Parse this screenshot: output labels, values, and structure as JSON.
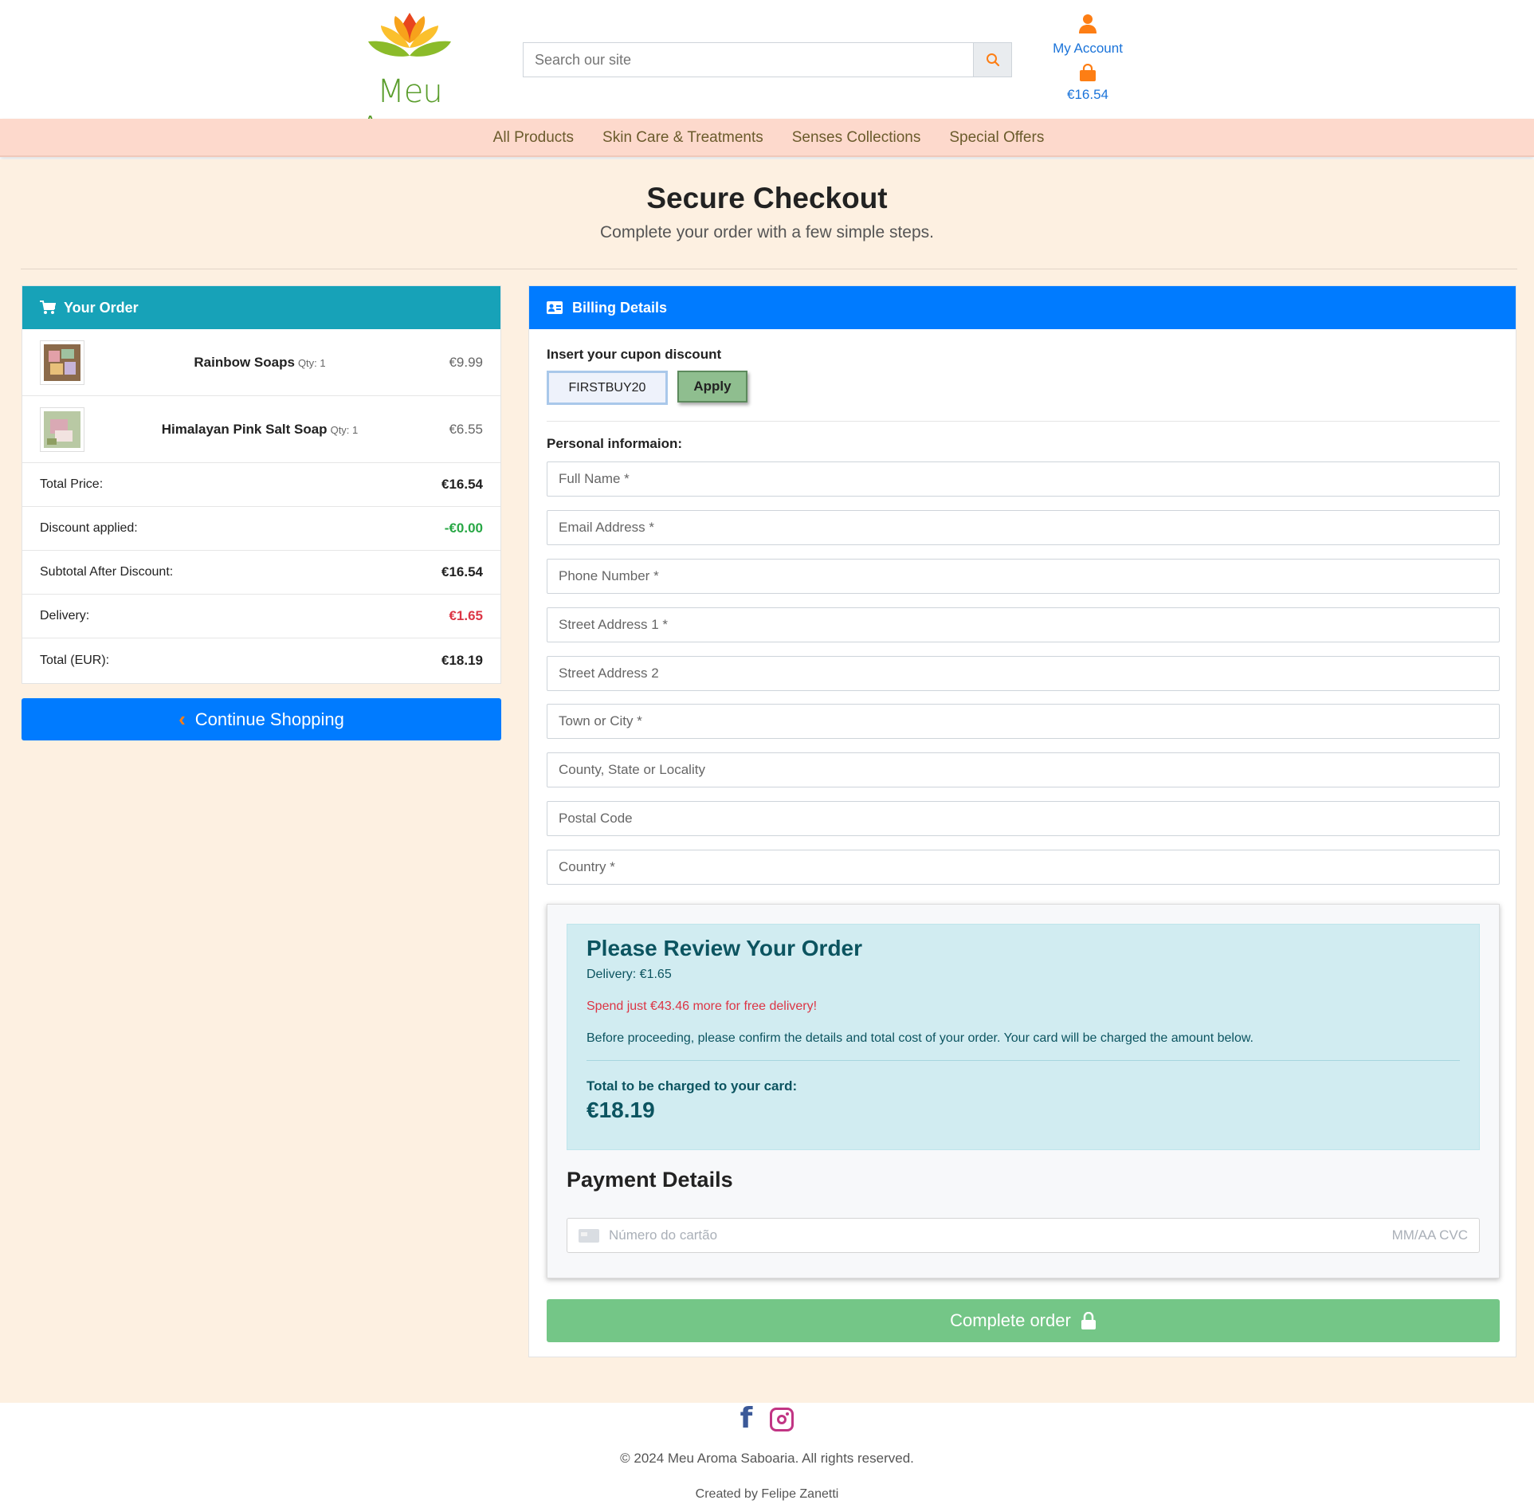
{
  "header": {
    "logo_text": "Meu Aroma",
    "search_placeholder": "Search our site",
    "account_label": "My Account",
    "bag_total": "€16.54"
  },
  "nav": {
    "items": [
      "All Products",
      "Skin Care & Treatments",
      "Senses Collections",
      "Special Offers"
    ]
  },
  "page": {
    "title": "Secure Checkout",
    "subtitle": "Complete your order with a few simple steps."
  },
  "order": {
    "heading": "Your Order",
    "items": [
      {
        "name": "Rainbow Soaps",
        "qty": "Qty: 1",
        "price": "€9.99"
      },
      {
        "name": "Himalayan Pink Salt Soap",
        "qty": "Qty: 1",
        "price": "€6.55"
      }
    ],
    "summary": [
      {
        "label": "Total Price:",
        "value": "€16.54"
      },
      {
        "label": "Discount applied:",
        "value": "-€0.00"
      },
      {
        "label": "Subtotal After Discount:",
        "value": "€16.54"
      },
      {
        "label": "Delivery:",
        "value": "€1.65"
      },
      {
        "label": "Total (EUR):",
        "value": "€18.19"
      }
    ],
    "continue_label": "Continue Shopping"
  },
  "billing": {
    "heading": "Billing Details",
    "cupon_label": "Insert your cupon discount",
    "cupon_value": "FIRSTBUY20",
    "apply_label": "Apply",
    "personal_label": "Personal informaion:",
    "fields": [
      "Full Name *",
      "Email Address *",
      "Phone Number *",
      "Street Address 1 *",
      "Street Address 2",
      "Town or City *",
      "County, State or Locality",
      "Postal Code",
      "Country *"
    ]
  },
  "review": {
    "title": "Please Review Your Order",
    "delivery": "Delivery: €1.65",
    "free_delivery": "Spend just €43.46 more for free delivery!",
    "note": "Before proceeding, please confirm the details and total cost of your order. Your card will be charged the amount below.",
    "charge_label": "Total to be charged to your card:",
    "charge_value": "€18.19"
  },
  "payment": {
    "title": "Payment Details",
    "card_placeholder": "Número do cartão",
    "exp_cvc": "MM/AA CVC",
    "complete_label": "Complete order"
  },
  "footer": {
    "copyright": "© 2024 Meu Aroma Saboaria. All rights reserved.",
    "creator": "Created by Felipe Zanetti"
  },
  "colors": {
    "nav_bg": "#fdd9cc",
    "page_bg": "#fdf0e1",
    "order_header": "#17a2b8",
    "billing_header": "#007bff",
    "complete_button": "#74c687",
    "accent_orange": "#fd7e14"
  }
}
